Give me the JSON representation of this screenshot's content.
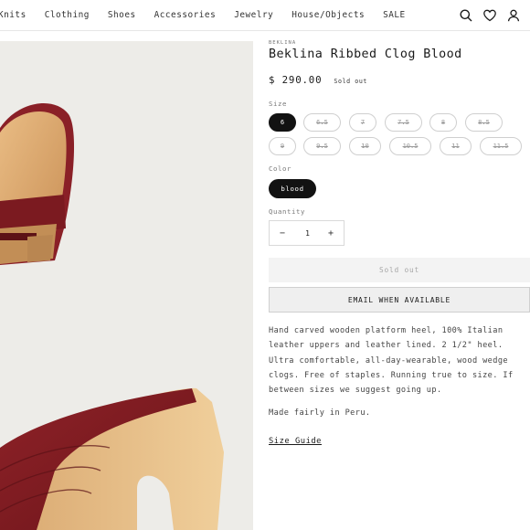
{
  "nav": {
    "links": [
      "Knits",
      "Clothing",
      "Shoes",
      "Accessories",
      "Jewelry",
      "House/Objects",
      "SALE"
    ],
    "icons": [
      "search-icon",
      "heart-icon",
      "user-icon"
    ]
  },
  "product": {
    "vendor": "BEKLINA",
    "title": "Beklina Ribbed Clog Blood",
    "price": "$ 290.00",
    "badge": "Sold out",
    "size_label": "Size",
    "sizes": [
      "6",
      "6.5",
      "7",
      "7.5",
      "8",
      "8.5",
      "9",
      "9.5",
      "10",
      "10.5",
      "11",
      "11.5"
    ],
    "selected_size": "6",
    "color_label": "Color",
    "color_value": "blood",
    "quantity_label": "Quantity",
    "quantity": "1",
    "minus": "−",
    "plus": "+",
    "soldout_button": "Sold out",
    "email_button": "EMAIL WHEN AVAILABLE",
    "description_lines": [
      "Hand carved wooden platform heel, 100% Italian",
      "leather uppers and leather lined. 2 1/2\" heel.",
      "Ultra comfortable, all-day-wearable, wood wedge",
      "clogs. Free of staples. Running true to size. If",
      "between sizes we suggest going up."
    ],
    "made": "Made fairly in Peru.",
    "size_guide": "Size Guide"
  }
}
